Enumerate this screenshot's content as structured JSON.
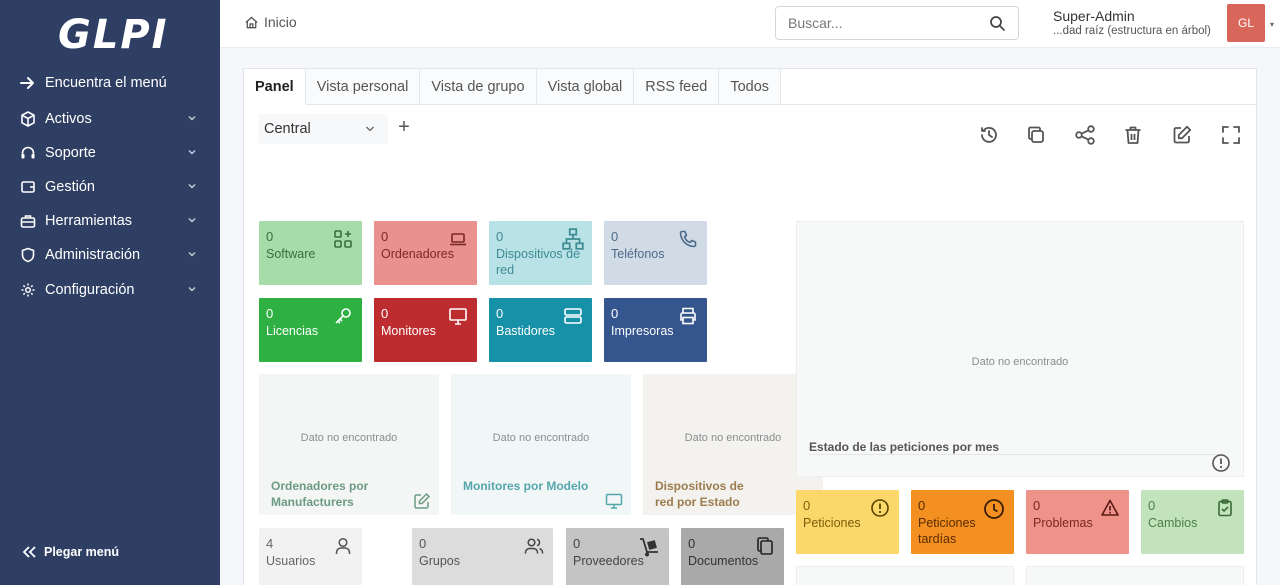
{
  "app": {
    "logo_text": "GLPI"
  },
  "sidebar": {
    "items": [
      {
        "label": "Encuentra el menú"
      },
      {
        "label": "Activos"
      },
      {
        "label": "Soporte"
      },
      {
        "label": "Gestión"
      },
      {
        "label": "Herramientas"
      },
      {
        "label": "Administración"
      },
      {
        "label": "Configuración"
      }
    ],
    "collapse_label": "Plegar menú"
  },
  "header": {
    "breadcrumb": "Inicio",
    "search_placeholder": "Buscar...",
    "user_name": "Super-Admin",
    "user_entity": "...dad raíz (estructura en árbol)",
    "avatar_initials": "GL"
  },
  "tabs": [
    {
      "label": "Panel"
    },
    {
      "label": "Vista personal"
    },
    {
      "label": "Vista de grupo"
    },
    {
      "label": "Vista global"
    },
    {
      "label": "RSS feed"
    },
    {
      "label": "Todos"
    }
  ],
  "dashboard": {
    "selected": "Central",
    "add_symbol": "+"
  },
  "asset_cards": [
    {
      "count": "0",
      "label": "Software",
      "bg": "#a8dbaa",
      "fg": "#3a6e3e"
    },
    {
      "count": "0",
      "label": "Ordenadores",
      "bg": "#e8918e",
      "fg": "#7a2a27"
    },
    {
      "count": "0",
      "label": "Dispositivos de red",
      "bg": "#b8e2e6",
      "fg": "#3d8b93"
    },
    {
      "count": "0",
      "label": "Teléfonos",
      "bg": "#d1dbe5",
      "fg": "#4c6a8a"
    },
    {
      "count": "0",
      "label": "Licencias",
      "bg": "#2eb043",
      "fg": "#ffffff"
    },
    {
      "count": "0",
      "label": "Monitores",
      "bg": "#bd2d30",
      "fg": "#ffffff"
    },
    {
      "count": "0",
      "label": "Bastidores",
      "bg": "#1691a8",
      "fg": "#ffffff"
    },
    {
      "count": "0",
      "label": "Impresoras",
      "bg": "#34558d",
      "fg": "#ffffff"
    }
  ],
  "charts": [
    {
      "not_found": "Dato no encontrado",
      "title": "Ordenadores por Manufacturers",
      "bg": "#f3f6f4",
      "fg": "#6d9a83"
    },
    {
      "not_found": "Dato no encontrado",
      "title": "Monitores por Modelo",
      "bg": "#f1f7f7",
      "fg": "#55a6ac"
    },
    {
      "not_found": "Dato no encontrado",
      "title": "Dispositivos de red por Estado",
      "bg": "#f3f2ee",
      "fg": "#9c7c4d"
    }
  ],
  "status_chart": {
    "not_found": "Dato no encontrado",
    "title": "Estado de las peticiones por mes"
  },
  "ticket_cards": [
    {
      "count": "0",
      "label": "Peticiones",
      "bg": "#fcd86a",
      "fg": "#7a5d0a"
    },
    {
      "count": "0",
      "label": "Peticiones tardías",
      "bg": "#f49022",
      "fg": "#5a2c00"
    },
    {
      "count": "0",
      "label": "Problemas",
      "bg": "#ef9289",
      "fg": "#7a2a22"
    },
    {
      "count": "0",
      "label": "Cambios",
      "bg": "#c3e3bd",
      "fg": "#4b7e47"
    }
  ],
  "admin_cards": [
    {
      "count": "4",
      "label": "Usuarios",
      "bg": "#f2f2f2",
      "fg": "#666666"
    },
    {
      "count": "0",
      "label": "Grupos",
      "bg": "#dcdcdc",
      "fg": "#555555"
    },
    {
      "count": "0",
      "label": "Proveedores",
      "bg": "#c4c4c4",
      "fg": "#444444"
    },
    {
      "count": "0",
      "label": "Documentos",
      "bg": "#a9a9a9",
      "fg": "#333333"
    }
  ]
}
